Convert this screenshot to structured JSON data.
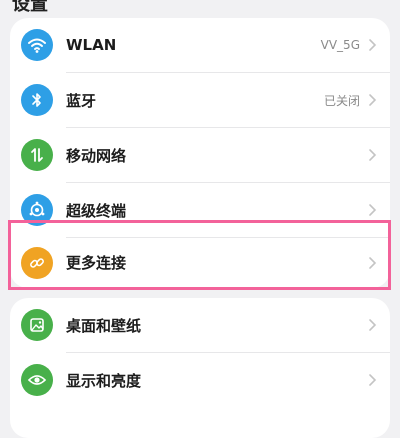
{
  "header": {
    "title": "设置"
  },
  "group1": {
    "items": [
      {
        "label": "WLAN",
        "value": "VV_5G",
        "icon": "wifi-icon",
        "color": "#2e9fe6"
      },
      {
        "label": "蓝牙",
        "value": "已关闭",
        "icon": "bluetooth-icon",
        "color": "#2e9fe6"
      },
      {
        "label": "移动网络",
        "value": "",
        "icon": "mobile-network-icon",
        "color": "#48b04a"
      },
      {
        "label": "超级终端",
        "value": "",
        "icon": "super-device-icon",
        "color": "#2e9fe6"
      },
      {
        "label": "更多连接",
        "value": "",
        "icon": "link-icon",
        "color": "#f0a323"
      }
    ]
  },
  "group2": {
    "items": [
      {
        "label": "桌面和壁纸",
        "icon": "wallpaper-icon",
        "color": "#48b04a"
      },
      {
        "label": "显示和亮度",
        "icon": "eye-icon",
        "color": "#48b04a"
      }
    ]
  },
  "highlight_color": "#f3629a"
}
